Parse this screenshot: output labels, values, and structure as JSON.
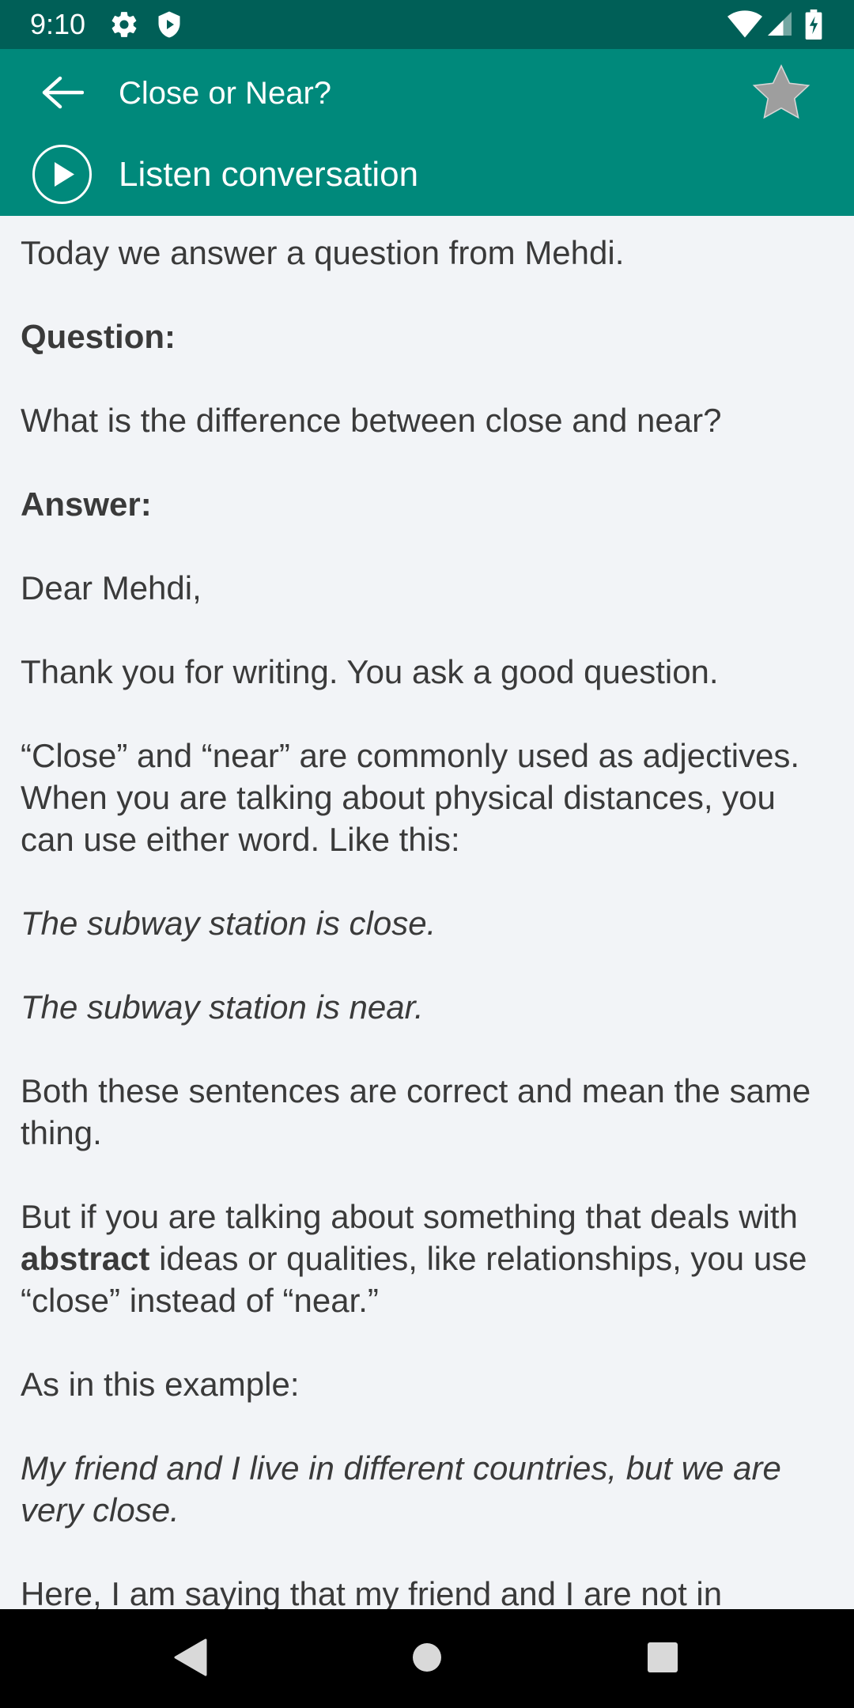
{
  "status_bar": {
    "time": "9:10",
    "left_icons": [
      "settings-icon",
      "shield-play-icon"
    ],
    "right_icons": [
      "wifi-icon",
      "cell-signal-icon",
      "battery-icon"
    ]
  },
  "app_bar": {
    "title": "Close or Near?",
    "listen_label": "Listen conversation",
    "icons": [
      "back-arrow-icon",
      "star-icon",
      "play-icon"
    ],
    "background_color": "#00897b",
    "status_color": "#005f57"
  },
  "article": {
    "intro": "Today we answer a question from Mehdi.",
    "question_heading": "Question:",
    "question_text": "What is the difference between close and near?",
    "answer_heading": "Answer:",
    "greeting": "Dear Mehdi,",
    "thanks": "Thank you for writing. You ask a good question.",
    "para_adjectives": "“Close” and “near” are commonly used as adjectives. When you are talking about physical distances, you can use either word. Like this:",
    "example1": "The subway station is close.",
    "example2": "The subway station is near.",
    "both_correct": "Both these sentences are correct and mean the same thing.",
    "abstract_part1": "But if you are talking about something that deals with",
    "abstract_bold": "abstract",
    "abstract_part2": "ideas or qualities, like relationships, you use “close” instead of “near.”",
    "as_in_example": "As in this example:",
    "example3": "My friend and I live in different countries, but we are very close.",
    "here_text": "Here, I am saying that my friend and I are not in"
  },
  "nav_bar": {
    "icons": [
      "back-triangle-icon",
      "home-circle-icon",
      "recents-square-icon"
    ]
  }
}
